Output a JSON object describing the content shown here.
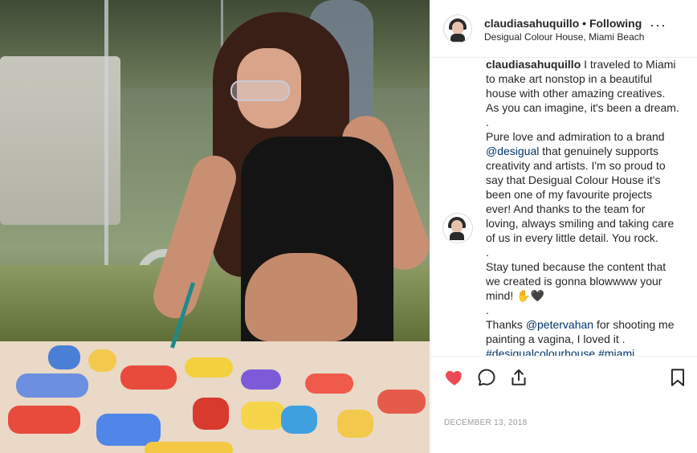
{
  "post": {
    "username": "claudiasahuquillo",
    "separator": "•",
    "follow_status": "Following",
    "location": "Desigual Colour House, Miami Beach",
    "more_glyph": "···"
  },
  "caption": {
    "lines": [
      {
        "text": "claudiasahuquillo",
        "type": "user"
      },
      {
        "text": "I traveled to Miami",
        "type": "text"
      },
      {
        "text": "to make art nonstop in a beautiful",
        "type": "text"
      },
      {
        "text": "house with other amazing creatives.",
        "type": "text"
      },
      {
        "text": "As you can imagine, it's been a dream.",
        "type": "text"
      },
      {
        "text": ".",
        "type": "text"
      },
      {
        "text": "Pure love and admiration to a brand",
        "type": "text"
      },
      {
        "text": "@desigual",
        "type": "tag"
      },
      {
        "text": "that genuinely supports",
        "type": "text"
      },
      {
        "text": "creativity and artists. I'm so proud to",
        "type": "text"
      },
      {
        "text": "say that Desigual Colour House it's",
        "type": "text"
      },
      {
        "text": "been one of my favourite projects",
        "type": "text"
      },
      {
        "text": "ever! And thanks to the team for",
        "type": "text"
      },
      {
        "text": "loving, always smiling and taking care",
        "type": "text"
      },
      {
        "text": "of us in every little detail. You rock.",
        "type": "text"
      },
      {
        "text": ".",
        "type": "text"
      },
      {
        "text": "Stay tuned because the content that",
        "type": "text"
      },
      {
        "text": "we created is gonna blowwww your",
        "type": "text"
      },
      {
        "text": "mind! ✋🖤",
        "type": "text"
      },
      {
        "text": ".",
        "type": "text"
      },
      {
        "text": "Thanks",
        "type": "text"
      },
      {
        "text": "@petervahan",
        "type": "tag"
      },
      {
        "text": "for shooting me",
        "type": "text"
      },
      {
        "text": "painting a vagina, I loved it .",
        "type": "text"
      },
      {
        "text": "#desigualcolourhouse #miami",
        "type": "tag"
      }
    ]
  },
  "actions": {
    "like_icon": "heart-filled-icon",
    "comment_icon": "comment-icon",
    "share_icon": "share-icon",
    "save_icon": "bookmark-icon",
    "like_color": "#ed4956"
  },
  "date": "DECEMBER 13, 2018"
}
